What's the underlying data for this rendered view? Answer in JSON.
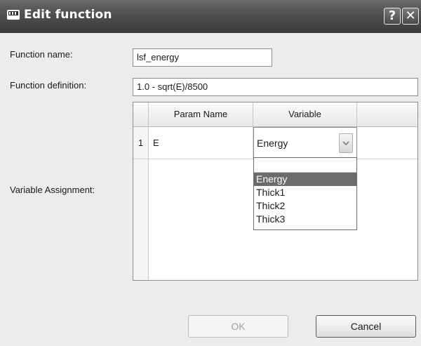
{
  "window": {
    "title": "Edit function"
  },
  "titlebar": {
    "help_glyph": "?",
    "close_glyph": "✕"
  },
  "form": {
    "function_name_label": "Function name:",
    "function_name_value": "lsf_energy",
    "function_definition_label": "Function definition:",
    "function_definition_value": "1.0 - sqrt(E)/8500",
    "variable_assignment_label": "Variable Assignment:"
  },
  "grid": {
    "columns": [
      "Param Name",
      "Variable"
    ],
    "rows": [
      {
        "index": "1",
        "param": "E",
        "variable": "Energy"
      }
    ]
  },
  "dropdown": {
    "options": [
      "Energy",
      "Thick1",
      "Thick2",
      "Thick3"
    ],
    "selected": "Energy"
  },
  "buttons": {
    "ok": "OK",
    "cancel": "Cancel"
  },
  "colors": {
    "titlebar": "#4e4e4e",
    "selection": "#6b6b6b",
    "dialog_bg": "#ececec"
  },
  "icons": {
    "app": "window-app-icon",
    "help": "help-icon",
    "close": "close-icon",
    "combo": "chevron-down-icon"
  }
}
